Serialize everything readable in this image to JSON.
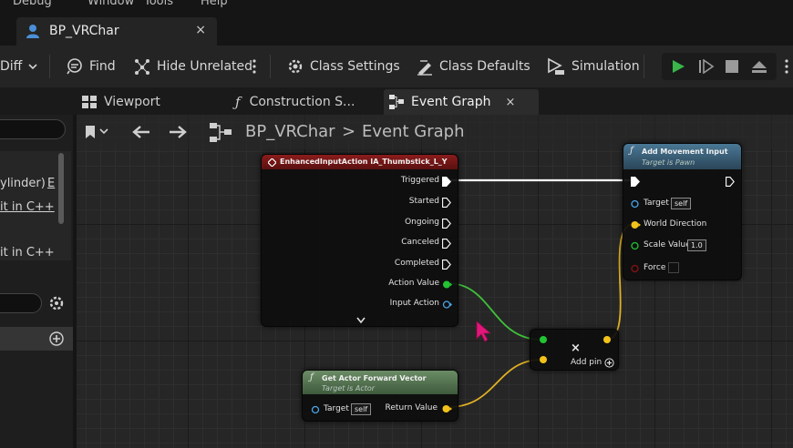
{
  "menu": [
    "Debug",
    "Window",
    "Tools",
    "Help"
  ],
  "document_tab": {
    "label": "BP_VRChar",
    "close": "×"
  },
  "toolbar": {
    "diff": "Diff",
    "find": "Find",
    "hide_unrelated": "Hide Unrelated",
    "class_settings": "Class Settings",
    "class_defaults": "Class Defaults",
    "simulation": "Simulation"
  },
  "sub_tabs": {
    "viewport": "Viewport",
    "construction": "Construction S...",
    "event_graph": "Event Graph",
    "close": "×"
  },
  "left_panel": {
    "line1": "ylinder)",
    "line1b": "E",
    "line2": "it in C++",
    "line3": "it in C++"
  },
  "breadcrumb": {
    "root": "BP_VRChar",
    "sep": ">",
    "current": "Event Graph"
  },
  "nodes": {
    "input_action": {
      "title": "EnhancedInputAction IA_Thumbstick_L_Y",
      "pins": [
        "Triggered",
        "Started",
        "Ongoing",
        "Canceled",
        "Completed",
        "Action Value",
        "Input Action"
      ]
    },
    "add_movement": {
      "title": "Add Movement Input",
      "subtitle": "Target is Pawn",
      "target": "Target",
      "target_value": "self",
      "world_direction": "World Direction",
      "scale_value": "Scale Value",
      "scale_value_value": "1.0",
      "force": "Force"
    },
    "add_pin_node": {
      "label": "Add pin",
      "x": "×"
    },
    "actor_forward": {
      "title": "Get Actor Forward Vector",
      "subtitle": "Target is Actor",
      "target": "Target",
      "target_value": "self",
      "return_value": "Return Value"
    }
  },
  "colors": {
    "exec": "#ffffff",
    "float_pin": "#22c433",
    "vector_pin": "#f3c21a",
    "object_pin": "#4aa6e8",
    "bool_pin": "#8b1111",
    "event_header": "#7c1616",
    "function_header": "#3d5f77",
    "pure_header": "#4c6b4a"
  }
}
